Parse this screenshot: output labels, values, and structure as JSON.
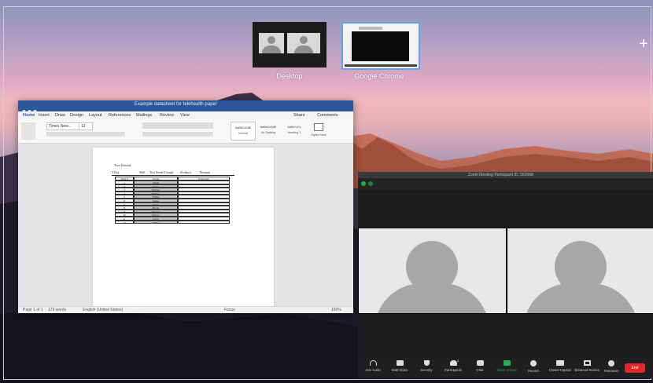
{
  "mission_control": {
    "spaces": [
      {
        "label": "Desktop"
      },
      {
        "label": "Google Chrome"
      }
    ],
    "add_space_label": "+"
  },
  "word": {
    "window_title": "Example datasheet for telehealth paper",
    "ribbon_tabs": [
      "Home",
      "Insert",
      "Draw",
      "Design",
      "Layout",
      "References",
      "Mailings",
      "Review",
      "View"
    ],
    "share_label": "Share",
    "comments_label": "Comments",
    "font_name": "Times New...",
    "font_size": "12",
    "style_names": [
      "AaBbCcDdE",
      "AaBbCcDdE",
      "AaBbCcDc",
      "AaBbC"
    ],
    "style_labels": [
      "Normal",
      "No Spacing",
      "Heading 1",
      "Styles Pane"
    ],
    "document": {
      "heading": "Two Round",
      "table_title_left": "T Day",
      "table_title_cols": [
        "Shift",
        "Text Needs (Group)",
        "(Fridays)",
        "Therapist"
      ],
      "headers": [
        "Trial #",
        "Target",
        "Response"
      ],
      "rows": [
        {
          "n": "1",
          "target": "Warm"
        },
        {
          "n": "2",
          "target": "Glow"
        },
        {
          "n": "3",
          "target": "Quarter"
        },
        {
          "n": "4",
          "target": "Smoke"
        },
        {
          "n": "5",
          "target": "Nickle"
        },
        {
          "n": "6",
          "target": "Glass"
        },
        {
          "n": "7",
          "target": "Straw"
        },
        {
          "n": "8",
          "target": "Blade"
        },
        {
          "n": "9",
          "target": "Quarter"
        },
        {
          "n": "10",
          "target": "Pillow"
        },
        {
          "n": "11",
          "target": "Glow"
        },
        {
          "n": "12",
          "target": "Tribe"
        }
      ]
    },
    "status": {
      "page": "Page 1 of 1",
      "words": "173 words",
      "language": "English (United States)",
      "focus": "Focus",
      "zoom": "150%"
    }
  },
  "zoom": {
    "window_title": "Zoom Meeting Participant ID: 562068",
    "toolbar": [
      {
        "label": "Join Audio",
        "icon": "headphones-icon"
      },
      {
        "label": "Start Video",
        "icon": "video-icon"
      },
      {
        "label": "Security",
        "icon": "shield-icon"
      },
      {
        "label": "Participants",
        "icon": "participants-icon"
      },
      {
        "label": "Chat",
        "icon": "chat-icon"
      },
      {
        "label": "Share Screen",
        "icon": "share-screen-icon"
      },
      {
        "label": "Record",
        "icon": "record-icon"
      },
      {
        "label": "Closed Caption",
        "icon": "cc-icon"
      },
      {
        "label": "Breakout Rooms",
        "icon": "breakout-icon"
      },
      {
        "label": "Reactions",
        "icon": "reactions-icon"
      }
    ],
    "end_label": "End",
    "participants_count": "2"
  },
  "colors": {
    "word_blue": "#2b579a",
    "zoom_dark": "#1d1d1d",
    "share_green": "#23b14d",
    "end_red": "#e02828",
    "avatar_gray": "#a7a7a7"
  }
}
